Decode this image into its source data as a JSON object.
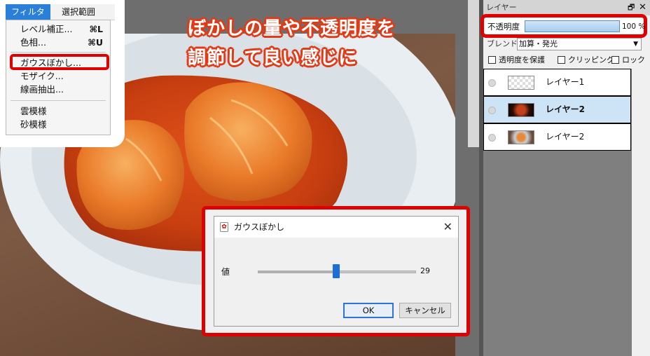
{
  "menu": {
    "bar": [
      "フィルタ",
      "選択範囲"
    ],
    "items": [
      {
        "label": "レベル補正...",
        "shortcut": "⌘L"
      },
      {
        "label": "色相...",
        "shortcut": "⌘U"
      },
      {
        "label": "ガウスぼかし...",
        "shortcut": ""
      },
      {
        "label": "モザイク...",
        "shortcut": ""
      },
      {
        "label": "線画抽出...",
        "shortcut": ""
      },
      {
        "label": "雲模様",
        "shortcut": ""
      },
      {
        "label": "砂模様",
        "shortcut": ""
      }
    ]
  },
  "headline": [
    "ぼかしの量や不透明度を",
    "調節して良い感じに"
  ],
  "dialog": {
    "title": "ガウスぼかし",
    "value_label": "値",
    "value": 29,
    "slider_fraction": 0.5,
    "ok_label": "OK",
    "cancel_label": "キャンセル"
  },
  "layer_panel": {
    "title": "レイヤー",
    "opacity_label": "不透明度",
    "opacity_value": "100 %",
    "opacity_percent": 100,
    "blend_label": "ブレンド",
    "blend_value": "加算・発光",
    "options": [
      "透明度を保護",
      "クリッピング",
      "ロック"
    ],
    "layers": [
      {
        "name": "レイヤー1",
        "selected": false
      },
      {
        "name": "レイヤー2",
        "selected": true
      },
      {
        "name": "レイヤー2",
        "selected": false
      }
    ]
  },
  "colors": {
    "highlight_red": "#e00000",
    "menu_active": "#2a7fd8",
    "slider_thumb": "#1c6fd6",
    "headline_outline": "#e03a17"
  }
}
